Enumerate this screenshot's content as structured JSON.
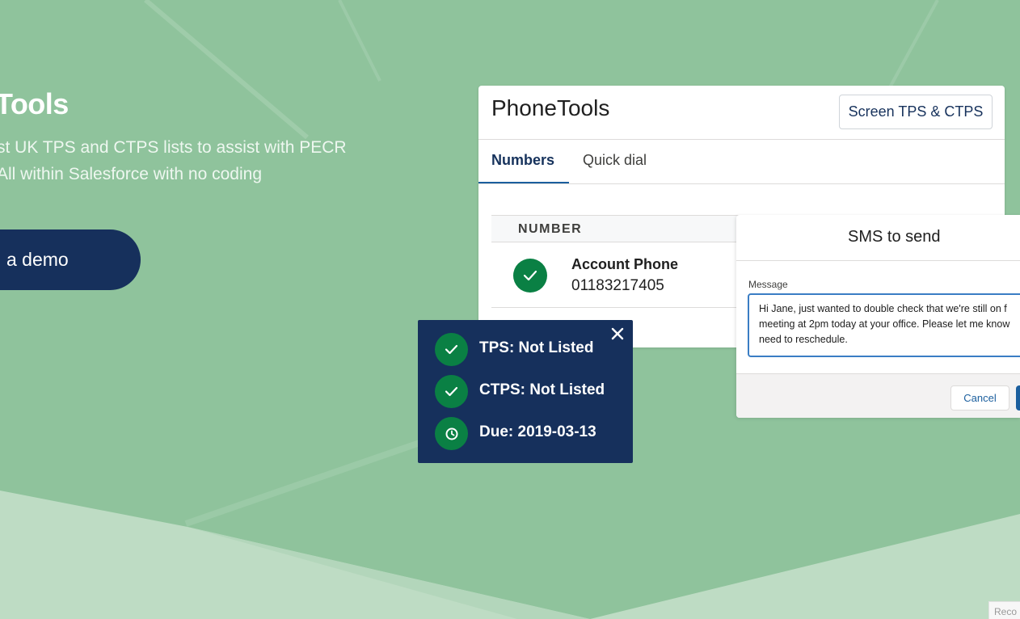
{
  "hero": {
    "title": "Tools",
    "subtitle_line1": "st UK TPS and CTPS lists to assist with PECR",
    "subtitle_line2": "All within Salesforce with no coding",
    "demo_button": "a demo"
  },
  "colors": {
    "background": "#8fc39c",
    "background_light": "#bedcc4",
    "navy": "#16305c",
    "green": "#0a8044",
    "accent_blue": "#1b5f9e"
  },
  "phonetools": {
    "title": "PhoneTools",
    "screen_button": "Screen TPS & CTPS",
    "tabs": [
      {
        "label": "Numbers",
        "active": true
      },
      {
        "label": "Quick dial",
        "active": false
      }
    ],
    "table": {
      "column_header": "NUMBER",
      "rows": [
        {
          "icon": "check-icon",
          "name": "Account Phone",
          "number": "01183217405"
        }
      ]
    }
  },
  "status_popover": {
    "close_icon": "close-icon",
    "items": [
      {
        "icon": "check-icon",
        "text": "TPS: Not Listed"
      },
      {
        "icon": "check-icon",
        "text": "CTPS: Not Listed"
      },
      {
        "icon": "clock-icon",
        "text": "Due: 2019-03-13"
      }
    ]
  },
  "sms": {
    "title": "SMS to send",
    "message_label": "Message",
    "message_value": "Hi Jane, just wanted to double check that we're still on f\nmeeting at 2pm today at your office. Please let me know\nneed to reschedule.",
    "cancel_button": "Cancel"
  },
  "recaptcha": {
    "text": "Reco"
  }
}
